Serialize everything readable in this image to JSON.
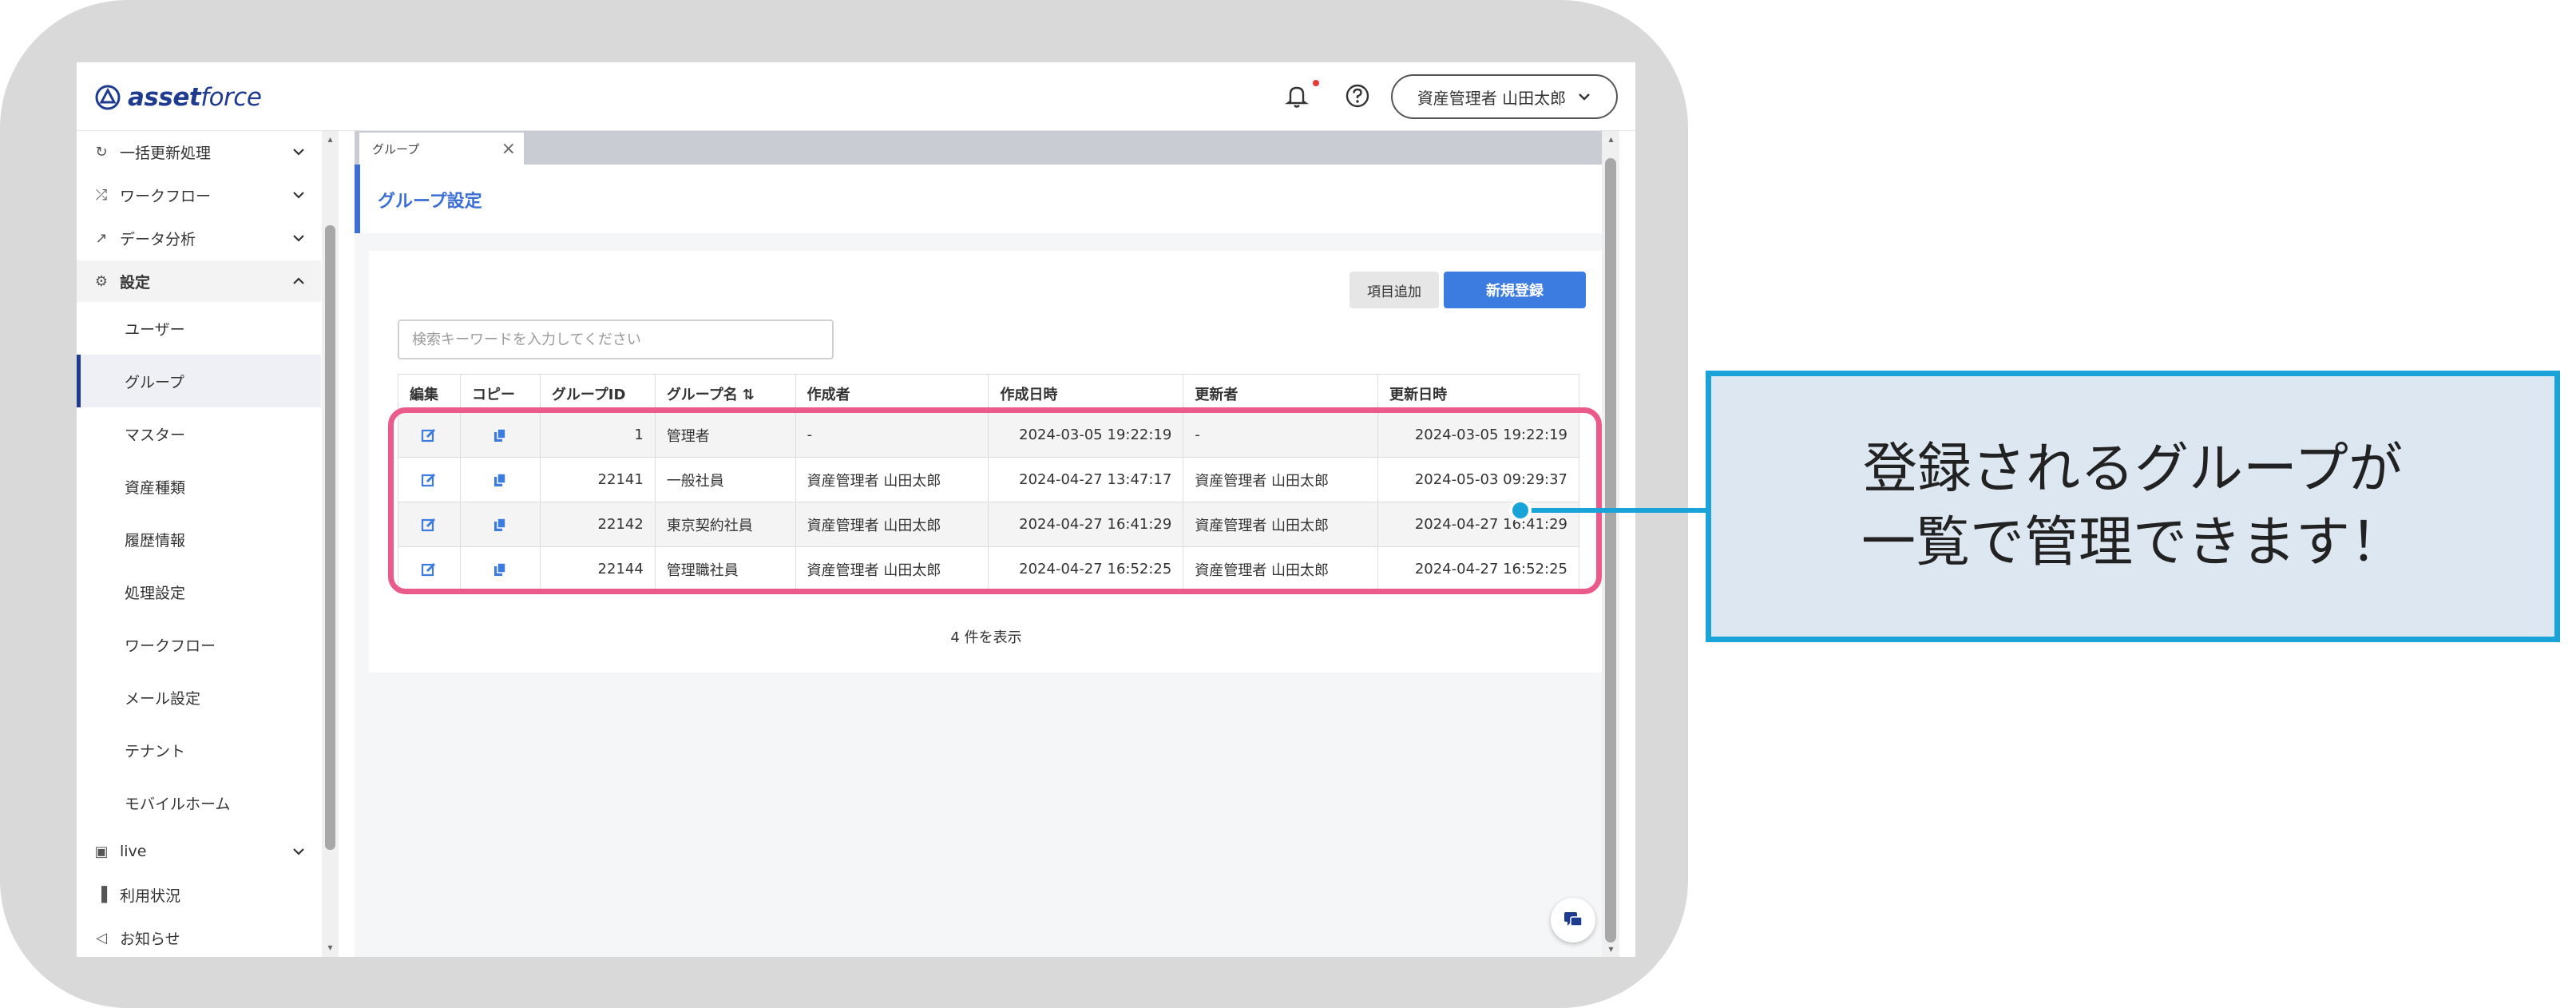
{
  "app": {
    "logo_text_bold": "asset",
    "logo_text_light": "force"
  },
  "header": {
    "user_label": "資産管理者 山田太郎"
  },
  "sidebar": {
    "items": [
      {
        "label": "一括更新処理",
        "icon": "refresh-icon"
      },
      {
        "label": "ワークフロー",
        "icon": "workflow-icon"
      },
      {
        "label": "データ分析",
        "icon": "analytics-icon"
      },
      {
        "label": "設定",
        "icon": "gear-icon"
      }
    ],
    "settings_sub_items": [
      "ユーザー",
      "グループ",
      "マスター",
      "資産種類",
      "履歴情報",
      "処理設定",
      "ワークフロー",
      "メール設定",
      "テナント",
      "モバイルホーム"
    ],
    "active_sub_item": "グループ",
    "bottom_items": [
      {
        "label": "live",
        "icon": "live-icon"
      },
      {
        "label": "利用状況",
        "icon": "bar-chart-icon"
      },
      {
        "label": "お知らせ",
        "icon": "megaphone-icon"
      }
    ]
  },
  "tabs": [
    {
      "label": "グループ"
    }
  ],
  "page": {
    "title": "グループ設定"
  },
  "toolbar": {
    "add_column_label": "項目追加",
    "new_label": "新規登録"
  },
  "search": {
    "placeholder": "検索キーワードを入力してください",
    "value": ""
  },
  "table": {
    "columns": [
      "編集",
      "コピー",
      "グループID",
      "グループ名",
      "作成者",
      "作成日時",
      "更新者",
      "更新日時"
    ],
    "rows": [
      {
        "id": "1",
        "name": "管理者",
        "creator": "-",
        "created": "2024-03-05 19:22:19",
        "updater": "-",
        "updated": "2024-03-05 19:22:19"
      },
      {
        "id": "22141",
        "name": "一般社員",
        "creator": "資産管理者 山田太郎",
        "created": "2024-04-27 13:47:17",
        "updater": "資産管理者 山田太郎",
        "updated": "2024-05-03 09:29:37"
      },
      {
        "id": "22142",
        "name": "東京契約社員",
        "creator": "資産管理者 山田太郎",
        "created": "2024-04-27 16:41:29",
        "updater": "資産管理者 山田太郎",
        "updated": "2024-04-27 16:41:29"
      },
      {
        "id": "22144",
        "name": "管理職社員",
        "creator": "資産管理者 山田太郎",
        "created": "2024-04-27 16:52:25",
        "updater": "資産管理者 山田太郎",
        "updated": "2024-04-27 16:52:25"
      }
    ],
    "count_label": "4 件を表示"
  },
  "callout": {
    "line1": "登録されるグループが",
    "line2": "一覧で管理できます！"
  },
  "colors": {
    "brand": "#1f3b8f",
    "accent": "#3c7be0",
    "highlight": "#ea5b8b",
    "callout_border": "#1aa3d9",
    "callout_bg": "#dde7f1"
  }
}
